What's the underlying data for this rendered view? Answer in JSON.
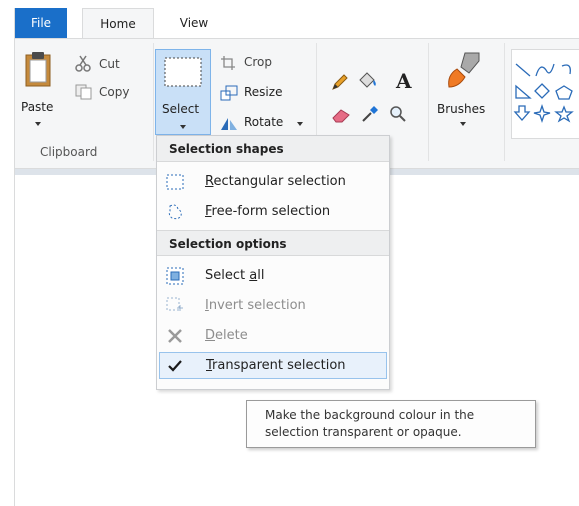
{
  "tabs": {
    "file": "File",
    "home": "Home",
    "view": "View"
  },
  "clipboard": {
    "paste": "Paste",
    "cut": "Cut",
    "copy": "Copy",
    "group_label": "Clipboard"
  },
  "image": {
    "crop": "Crop",
    "resize": "Resize",
    "rotate": "Rotate",
    "select": "Select"
  },
  "brushes": {
    "label": "Brushes"
  },
  "menu": {
    "section1_header": "Selection shapes",
    "items1": [
      {
        "label": "Rectangular selection",
        "mnemonic": "R",
        "rest": "ectangular selection",
        "icon": "rectangle-select-icon",
        "disabled": false
      },
      {
        "label": "Free-form selection",
        "mnemonic": "F",
        "rest": "ree-form selection",
        "icon": "freeform-select-icon",
        "disabled": false
      }
    ],
    "section2_header": "Selection options",
    "items2": [
      {
        "label": "Select all",
        "prefix": "Select ",
        "mnemonic": "a",
        "rest": "ll",
        "icon": "select-all-icon",
        "disabled": false
      },
      {
        "label": "Invert selection",
        "mnemonic": "I",
        "rest": "nvert selection",
        "icon": "invert-selection-icon",
        "disabled": true
      },
      {
        "label": "Delete",
        "mnemonic": "D",
        "rest": "elete",
        "icon": "delete-icon",
        "disabled": true
      },
      {
        "label": "Transparent selection",
        "mnemonic": "T",
        "rest": "ransparent selection",
        "icon": "checkmark-icon",
        "disabled": false,
        "checked": true
      }
    ]
  },
  "tooltip": {
    "line1": "Make the background colour in the",
    "line2": "selection transparent or opaque."
  },
  "colors": {
    "accent": "#1a6fc9",
    "highlight": "#c9e0f7"
  }
}
